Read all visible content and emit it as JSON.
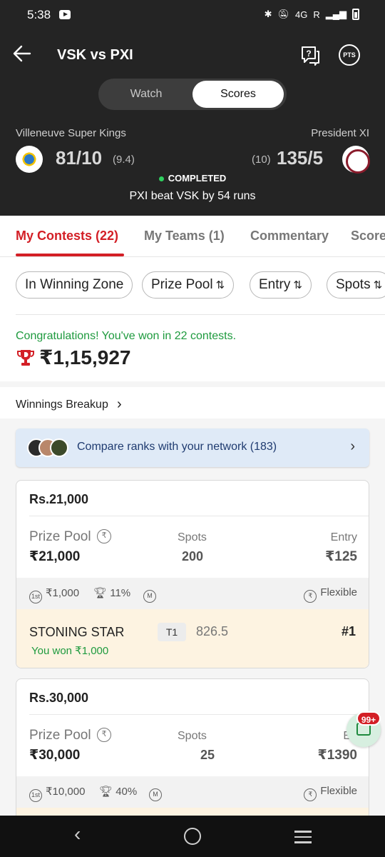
{
  "status_bar": {
    "time": "5:38",
    "network": "4G",
    "roaming": "R"
  },
  "header": {
    "title": "VSK vs PXI",
    "pts_label": "PTS"
  },
  "toggle": {
    "watch": "Watch",
    "scores": "Scores",
    "selected": "Scores"
  },
  "match": {
    "team_left": {
      "name": "Villeneuve Super Kings",
      "score": "81/10",
      "overs": "(9.4)"
    },
    "team_right": {
      "name": "President XI",
      "score": "135/5",
      "overs": "(10)"
    },
    "status": "COMPLETED",
    "result": "PXI beat VSK by 54 runs"
  },
  "tabs": [
    {
      "label": "My Contests (22)",
      "active": true
    },
    {
      "label": "My Teams (1)",
      "active": false
    },
    {
      "label": "Commentary",
      "active": false
    },
    {
      "label": "Score",
      "active": false
    }
  ],
  "filters": {
    "winning_zone": "In Winning Zone",
    "prize_pool": "Prize Pool",
    "entry": "Entry",
    "spots": "Spots",
    "sort_icon": "⇅"
  },
  "summary": {
    "congrats": "Congratulations! You've won in 22 contests.",
    "total_winnings": "₹1,15,927"
  },
  "breakup": {
    "label": "Winnings Breakup",
    "chevron": "›"
  },
  "compare": {
    "text": "Compare ranks with your network (183)",
    "chevron": "›"
  },
  "contests": [
    {
      "title": "Rs.21,000",
      "prize_pool_label": "Prize Pool",
      "prize_pool": "₹21,000",
      "spots_label": "Spots",
      "spots": "200",
      "entry_label": "Entry",
      "entry": "₹125",
      "first_prize": "₹1,000",
      "winners_pct": "11%",
      "multi_entry": "M",
      "flexible": "Flexible",
      "team_name": "STONING STAR",
      "team_tag": "T1",
      "points": "826.5",
      "rank": "#1",
      "won": "You won ₹1,000"
    },
    {
      "title": "Rs.30,000",
      "prize_pool_label": "Prize Pool",
      "prize_pool": "₹30,000",
      "spots_label": "Spots",
      "spots": "25",
      "entry_label": "En",
      "entry": "₹1390",
      "first_prize": "₹10,000",
      "winners_pct": "40%",
      "multi_entry": "M",
      "flexible": "Flexible"
    }
  ],
  "chat": {
    "badge": "99+"
  },
  "icons": [
    "back-arrow-icon",
    "help-chat-icon",
    "pts-icon",
    "trophy-icon",
    "sort-icon",
    "chevron-right-icon",
    "rupee-cycle-icon",
    "first-prize-icon",
    "trophy-small-icon",
    "multi-entry-icon",
    "chat-icon"
  ],
  "colors": {
    "accent": "#d31f26",
    "success": "#1e9a3e",
    "header_bg": "#242424",
    "compare_bg": "#dfeaf7",
    "win_row_bg": "#fdf3e1"
  }
}
